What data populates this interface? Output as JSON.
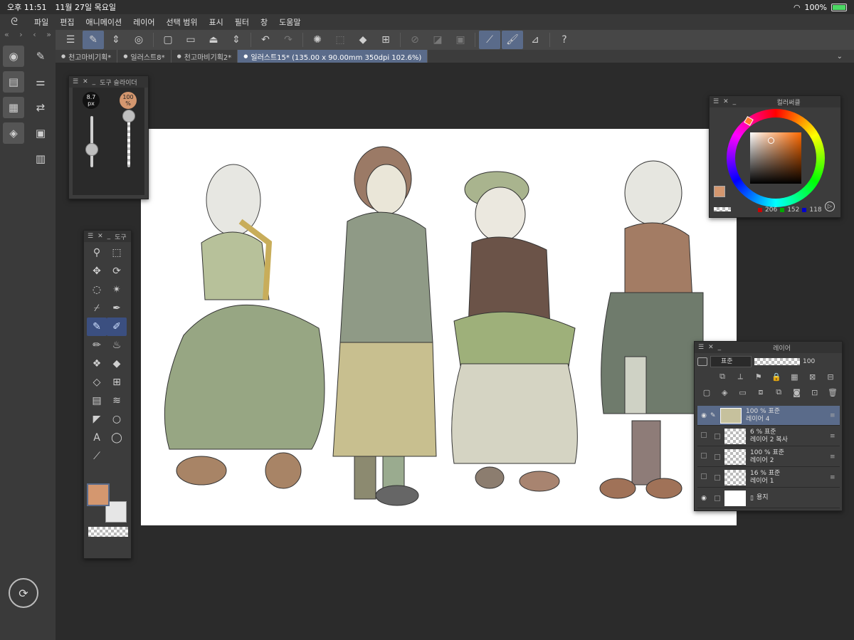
{
  "status": {
    "time": "오후 11:51",
    "date": "11월 27일 목요일",
    "battery": "100%"
  },
  "menu": [
    "파일",
    "편집",
    "애니메이션",
    "레이어",
    "선택 범위",
    "표시",
    "필터",
    "창",
    "도움말"
  ],
  "tabs": [
    {
      "label": "천고마비기획*",
      "active": false
    },
    {
      "label": "일러스트8*",
      "active": false
    },
    {
      "label": "천고마비기획2*",
      "active": false
    },
    {
      "label": "일러스트15* (135.00 x 90.00mm 350dpi 102.6%)",
      "active": true
    }
  ],
  "brush_slider": {
    "title": "도구 슬라이더",
    "size_label": "8.7 px",
    "opacity_label": "100 %",
    "size_level": 0.35,
    "opacity_level": 1.0
  },
  "tool_panel": {
    "title": "도구",
    "tools": [
      "zoom-icon",
      "object-icon",
      "move-icon",
      "rotate-icon",
      "lasso-icon",
      "magic-wand-icon",
      "eyedropper-icon",
      "pen-nib-icon",
      "pen-icon",
      "pen-blue-icon",
      "pencil-icon",
      "brush-icon",
      "blend-icon",
      "fill-icon",
      "eraser-icon",
      "grid-icon",
      "gradient-icon",
      "figure-icon",
      "ruler-icon",
      "circle-icon",
      "text-icon",
      "balloon-icon",
      "line-icon"
    ],
    "main_color": "#d4976f",
    "sub_color": "#e6e6e6"
  },
  "color_circle": {
    "title": "컬러써클",
    "r": "206",
    "g": "152",
    "b": "118"
  },
  "layers": {
    "title": "레이어",
    "blend_mode": "표준",
    "opacity": "100",
    "items": [
      {
        "line1": "100 % 표준",
        "line2": "레이어 4",
        "visible": true,
        "selected": true
      },
      {
        "line1": "6 % 표준",
        "line2": "레이어 2 복사",
        "visible": false,
        "selected": false
      },
      {
        "line1": "100 % 표준",
        "line2": "레이어 2",
        "visible": false,
        "selected": false
      },
      {
        "line1": "16 % 표준",
        "line2": "레이어 1",
        "visible": false,
        "selected": false
      },
      {
        "line1": "",
        "line2": "용지",
        "visible": true,
        "selected": false
      }
    ]
  }
}
